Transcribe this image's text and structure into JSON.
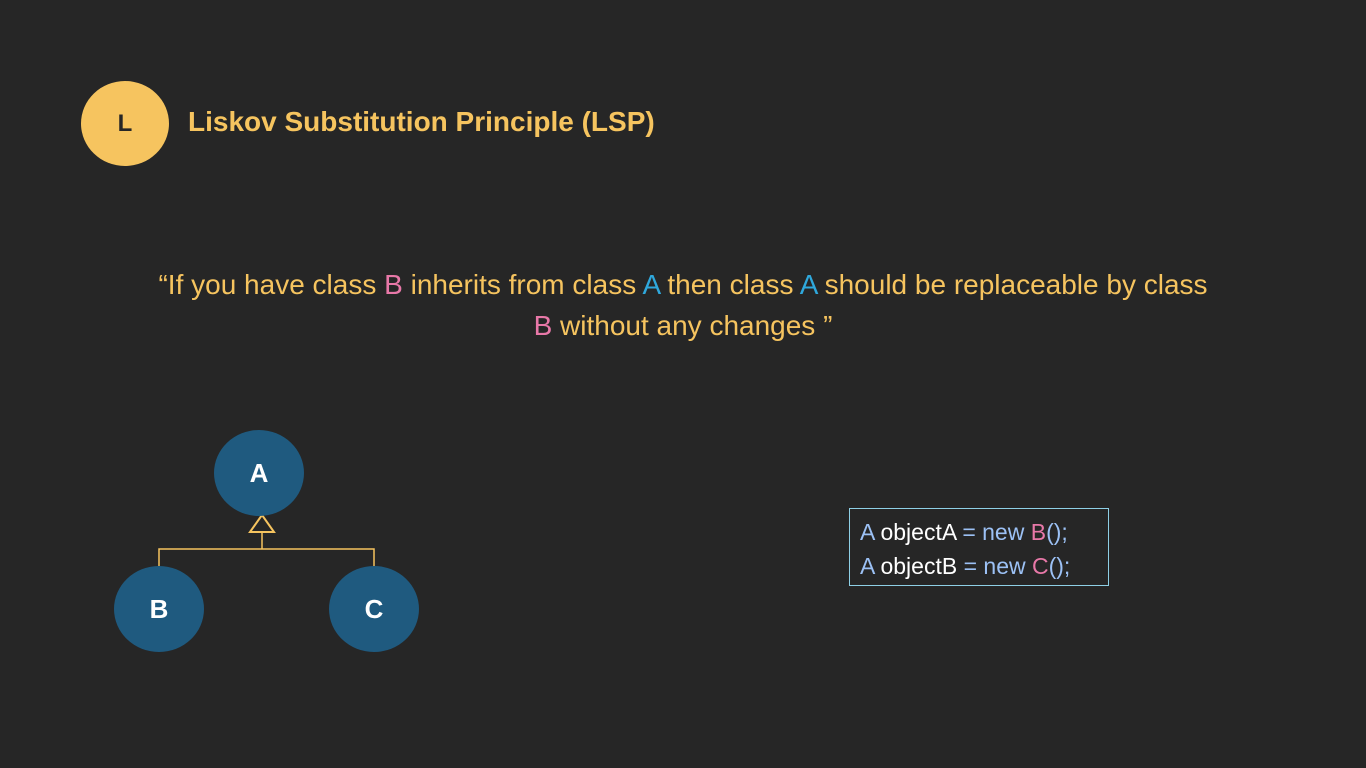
{
  "header": {
    "badge_letter": "L",
    "title": "Liskov Substitution Principle (LSP)"
  },
  "quote": {
    "open": "“If you have class ",
    "b1": "B",
    "mid1": " inherits from class ",
    "a1": "A",
    "mid2": " then class ",
    "a2": "A",
    "mid3": " should be replaceable by class",
    "b2": "B",
    "end": " without any changes ”"
  },
  "diagram": {
    "nodes": [
      "A",
      "B",
      "C"
    ]
  },
  "code": {
    "lines": [
      {
        "type": "A",
        "var": " objectA ",
        "eq": "= new ",
        "cls": "B",
        "tail": "();"
      },
      {
        "type": "A",
        "var": " objectB ",
        "eq": "= new ",
        "cls": "C",
        "tail": "();"
      }
    ]
  },
  "colors": {
    "background": "#262626",
    "accent": "#f6c45f",
    "node": "#1f5a7f",
    "pink": "#e878a8",
    "blue": "#2fa8dc"
  }
}
